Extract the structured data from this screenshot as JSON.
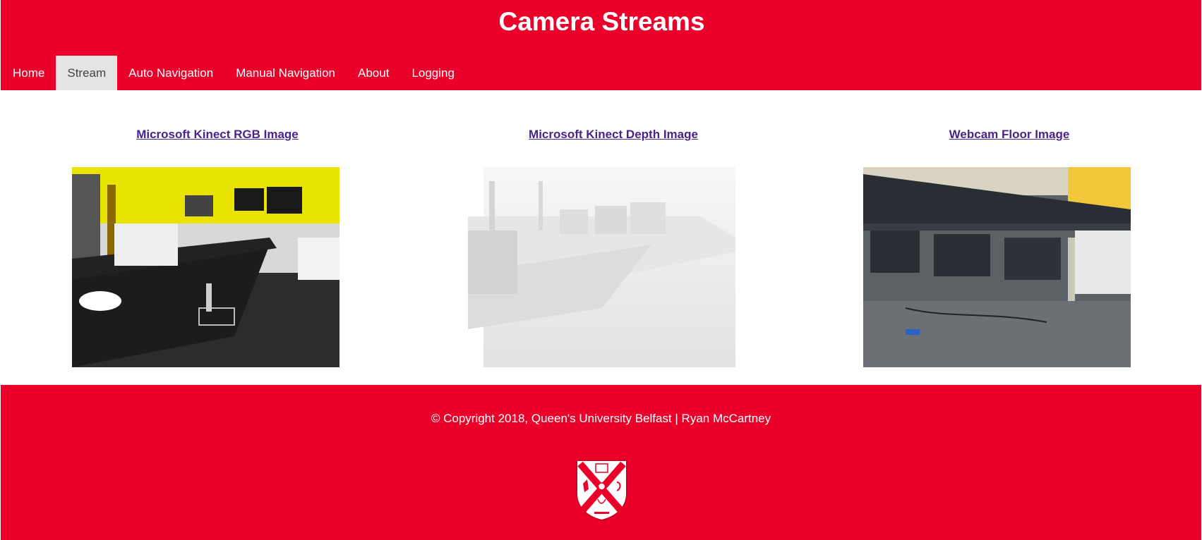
{
  "header": {
    "title": "Camera Streams",
    "nav": [
      {
        "label": "Home",
        "active": false
      },
      {
        "label": "Stream",
        "active": true
      },
      {
        "label": "Auto Navigation",
        "active": false
      },
      {
        "label": "Manual Navigation",
        "active": false
      },
      {
        "label": "About",
        "active": false
      },
      {
        "label": "Logging",
        "active": false
      }
    ]
  },
  "streams": [
    {
      "title": "Microsoft Kinect RGB Image"
    },
    {
      "title": "Microsoft Kinect Depth Image"
    },
    {
      "title": "Webcam Floor Image"
    }
  ],
  "footer": {
    "copyright": "© Copyright 2018, Queen's University Belfast | Ryan McCartney"
  },
  "colors": {
    "brand": "#eb002a",
    "nav_active_bg": "#e4e4e4",
    "link": "#4a2288"
  }
}
